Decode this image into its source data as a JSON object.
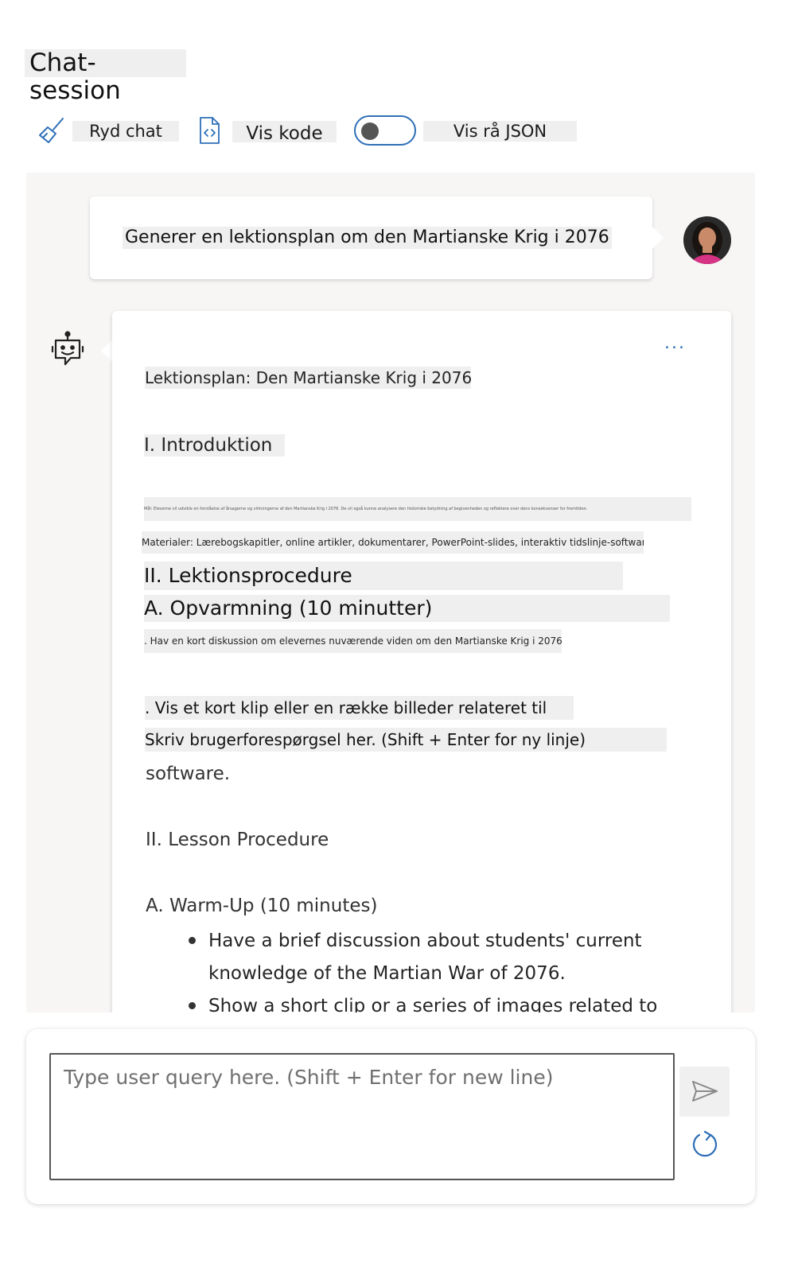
{
  "header": {
    "title": "Chat-session"
  },
  "toolbar": {
    "clear_label": "Ryd chat",
    "view_code_label": "Vis kode",
    "raw_json_label": "Vis rå JSON",
    "raw_json_enabled": false
  },
  "chat": {
    "user_message": "Generer en lektionsplan om den Martianske Krig i 2076",
    "more_options": "...",
    "response_overlay": {
      "heading": "Lektionsplan: Den Martianske Krig i 2076",
      "intro": "I. Introduktion",
      "objective_line": "Mål: Eleverne vil udvikle en forståelse af årsagerne og virkningerne af den Martianske Krig i 2076. De vil også kunne analysere den historiske betydning af begivenheden og reflektere over dens konsekvenser for fremtiden.",
      "materials": "Materialer: Lærebogskapitler, online artikler, dokumentarer, PowerPoint-slides, interaktiv tidslinje-software.",
      "procedure": "II. Lektionsprocedure",
      "warmup": "A. Opvarmning (10 minutter)",
      "warmup_item1": ". Hav en kort diskussion om elevernes nuværende viden om den Martianske Krig i 2076.",
      "warmup_item2": ". Vis et kort klip eller en række billeder relateret til",
      "placeholder_overlay": "Skriv brugerforespørgsel her. (Shift + Enter for ny linje)"
    },
    "response_rendered": {
      "software": "software.",
      "procedure": "II. Lesson Procedure",
      "warmup": "A. Warm-Up (10 minutes)",
      "bullet1_line1": "Have a brief discussion about students' current",
      "bullet1_line2": "knowledge of the Martian War of 2076.",
      "bullet2": "Show a short clip or a series of images related to"
    }
  },
  "input": {
    "placeholder": "Type user query here. (Shift + Enter for new line)"
  },
  "icons": {
    "clear": "broom-icon",
    "code": "code-file-icon",
    "bot": "bot-icon",
    "send": "send-icon",
    "refresh": "refresh-icon"
  },
  "colors": {
    "accent": "#2f6fb8",
    "chat_background": "#f7f6f5",
    "highlight": "#efefef"
  }
}
